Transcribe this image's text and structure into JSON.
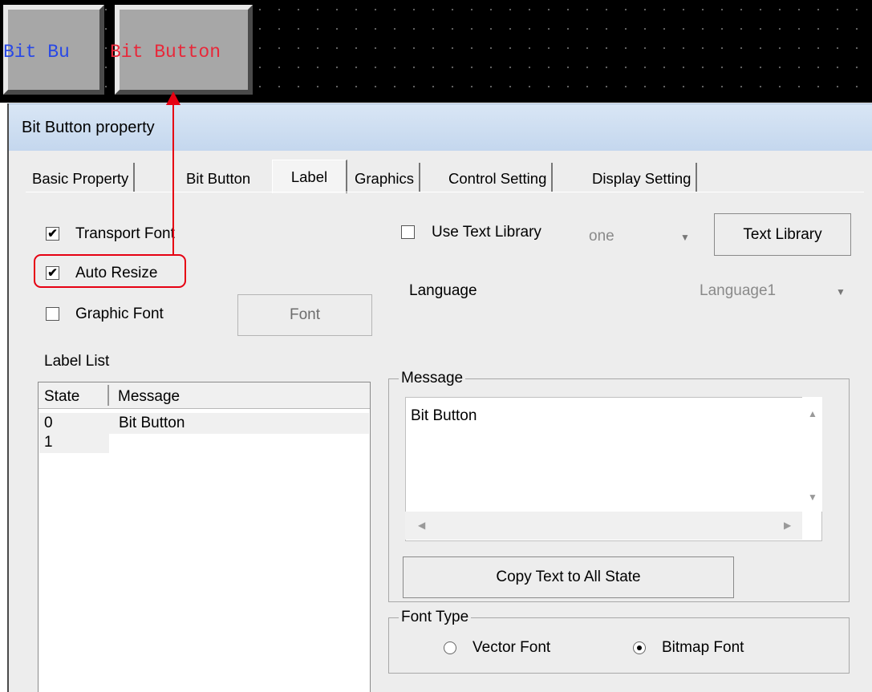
{
  "canvas": {
    "left_button_text": "Bit Bu",
    "right_button_text": "Bit Button"
  },
  "dialog": {
    "title": "Bit Button property",
    "tabs": [
      "Basic Property",
      "Bit Button",
      "Label",
      "Graphics",
      "Control Setting",
      "Display Setting"
    ],
    "active_tab": "Label"
  },
  "options": {
    "transport_font": {
      "label": "Transport Font",
      "checked": true
    },
    "auto_resize": {
      "label": "Auto Resize",
      "checked": true
    },
    "graphic_font": {
      "label": "Graphic Font",
      "checked": false
    },
    "font_button": "Font",
    "use_text_library": {
      "label": "Use Text Library",
      "checked": false
    },
    "text_library_value": "one",
    "text_library_button": "Text Library",
    "language_label": "Language",
    "language_value": "Language1"
  },
  "label_list": {
    "title": "Label List",
    "columns": [
      "State",
      "Message"
    ],
    "rows": [
      {
        "state": "0",
        "message": "Bit Button"
      },
      {
        "state": "1",
        "message": ""
      }
    ]
  },
  "message": {
    "title": "Message",
    "text": "Bit Button",
    "copy_button": "Copy Text to All State"
  },
  "font_type": {
    "title": "Font Type",
    "vector": "Vector Font",
    "bitmap": "Bitmap Font",
    "selected": "Bitmap Font"
  },
  "icons": {
    "check": "✔",
    "chevron": "▼",
    "scroll_up": "▲",
    "scroll_down": "▼",
    "scroll_left": "◀",
    "scroll_right": "▶"
  },
  "colors": {
    "highlight": "#e60012",
    "canvas_blue_text": "#2848e6",
    "canvas_red_text": "#e8283a"
  }
}
